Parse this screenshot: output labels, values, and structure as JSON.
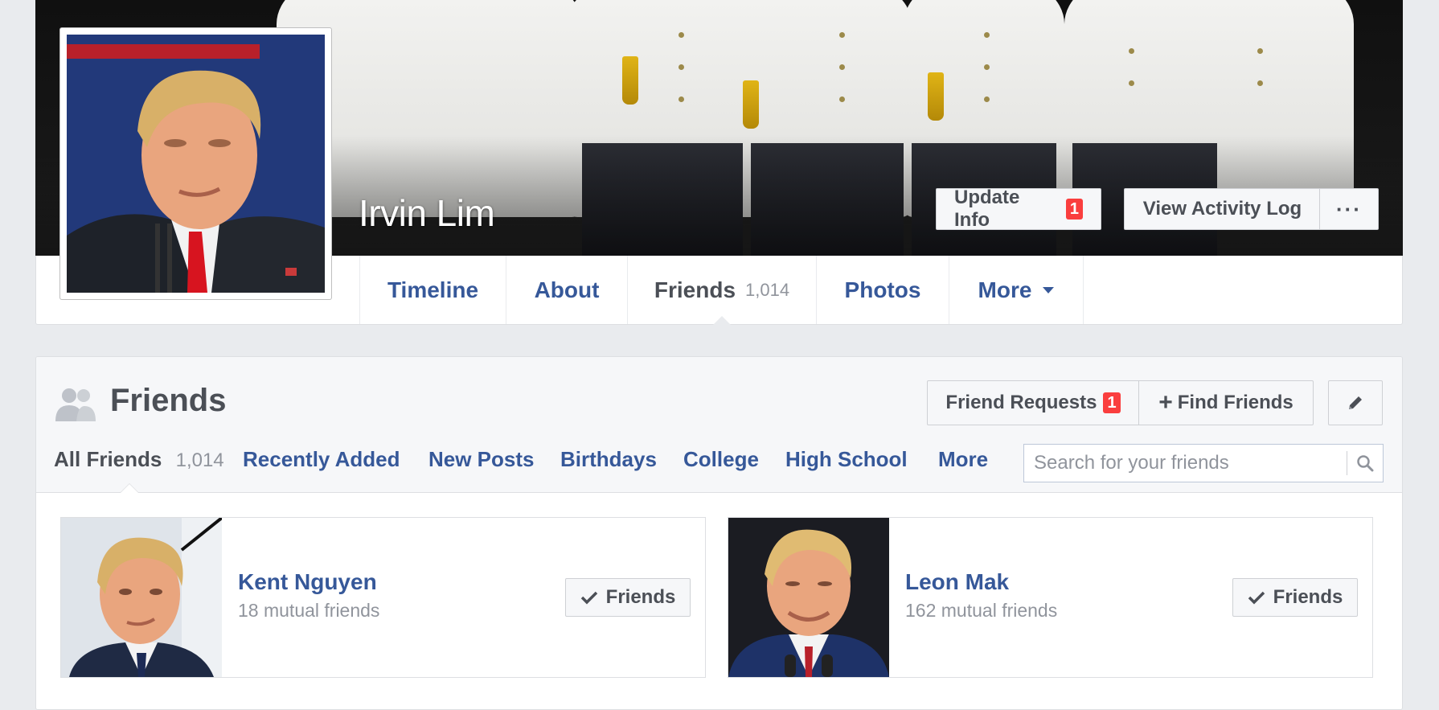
{
  "profile": {
    "name": "Irvin Lim",
    "update_info_label": "Update Info",
    "update_info_badge": "1",
    "activity_log_label": "View Activity Log",
    "more_dots": "···"
  },
  "tabs": [
    {
      "label": "Timeline"
    },
    {
      "label": "About"
    },
    {
      "label": "Friends",
      "count": "1,014"
    },
    {
      "label": "Photos"
    },
    {
      "label": "More"
    }
  ],
  "friends_section": {
    "title": "Friends",
    "friend_requests_label": "Friend Requests",
    "friend_requests_badge": "1",
    "find_friends_label": "Find Friends",
    "subtabs": [
      {
        "label": "All Friends",
        "count": "1,014"
      },
      {
        "label": "Recently Added"
      },
      {
        "label": "New Posts"
      },
      {
        "label": "Birthdays"
      },
      {
        "label": "College"
      },
      {
        "label": "High School"
      },
      {
        "label": "More"
      }
    ],
    "search_placeholder": "Search for your friends"
  },
  "friends": [
    {
      "name": "Kent Nguyen",
      "mutual": "18 mutual friends",
      "button": "Friends"
    },
    {
      "name": "Leon Mak",
      "mutual": "162 mutual friends",
      "button": "Friends"
    }
  ],
  "colors": {
    "link": "#365899",
    "badge": "#fa3e3e",
    "page_bg": "#e9ebee"
  }
}
